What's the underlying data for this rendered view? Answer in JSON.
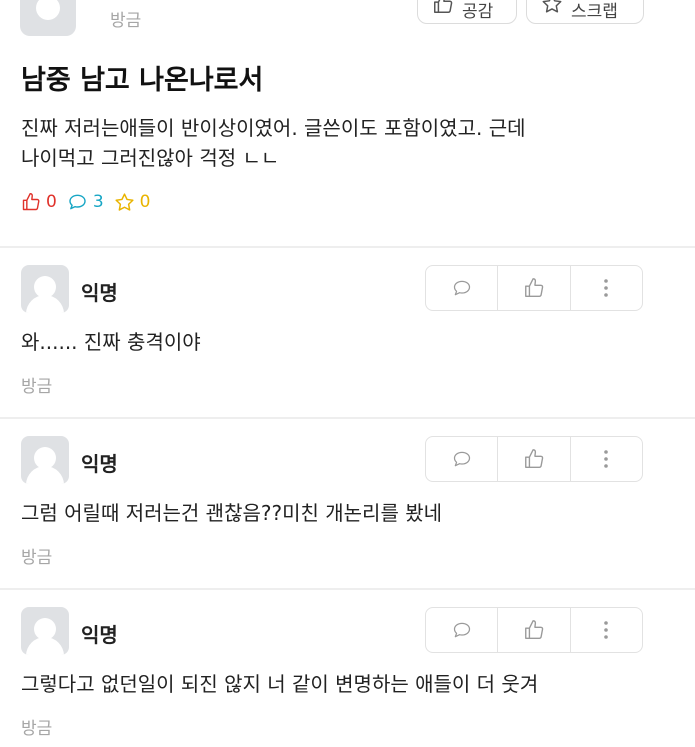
{
  "post": {
    "time": "방금",
    "buttons": {
      "like_label": "공감",
      "scrap_label": "스크랩"
    },
    "title": "남중 남고 나온나로서",
    "body_lines": [
      "진짜 저러는애들이 반이상이였어. 글쓴이도 포함이였고. 근데",
      "나이먹고 그러진않아 걱정 ㄴㄴ"
    ],
    "stats": {
      "likes": "0",
      "comments": "3",
      "scraps": "0"
    }
  },
  "comments": [
    {
      "author": "익명",
      "text": "와...... 진짜 충격이야",
      "time": "방금"
    },
    {
      "author": "익명",
      "text": "그럼 어릴때 저러는건 괜찮음??미친 개논리를 봤네",
      "time": "방금"
    },
    {
      "author": "익명",
      "text": "그렇다고 없던일이 되진 않지 너 같이 변명하는 애들이 더 웃겨",
      "time": "방금"
    }
  ],
  "colors": {
    "like": "#e0322b",
    "comment": "#17a6c5",
    "scrap": "#e9b400",
    "muted": "#a6a6a6"
  },
  "icons": {
    "like": "thumbs-up-icon",
    "comment": "speech-bubble-icon",
    "scrap": "star-icon",
    "more": "more-vertical-icon"
  }
}
